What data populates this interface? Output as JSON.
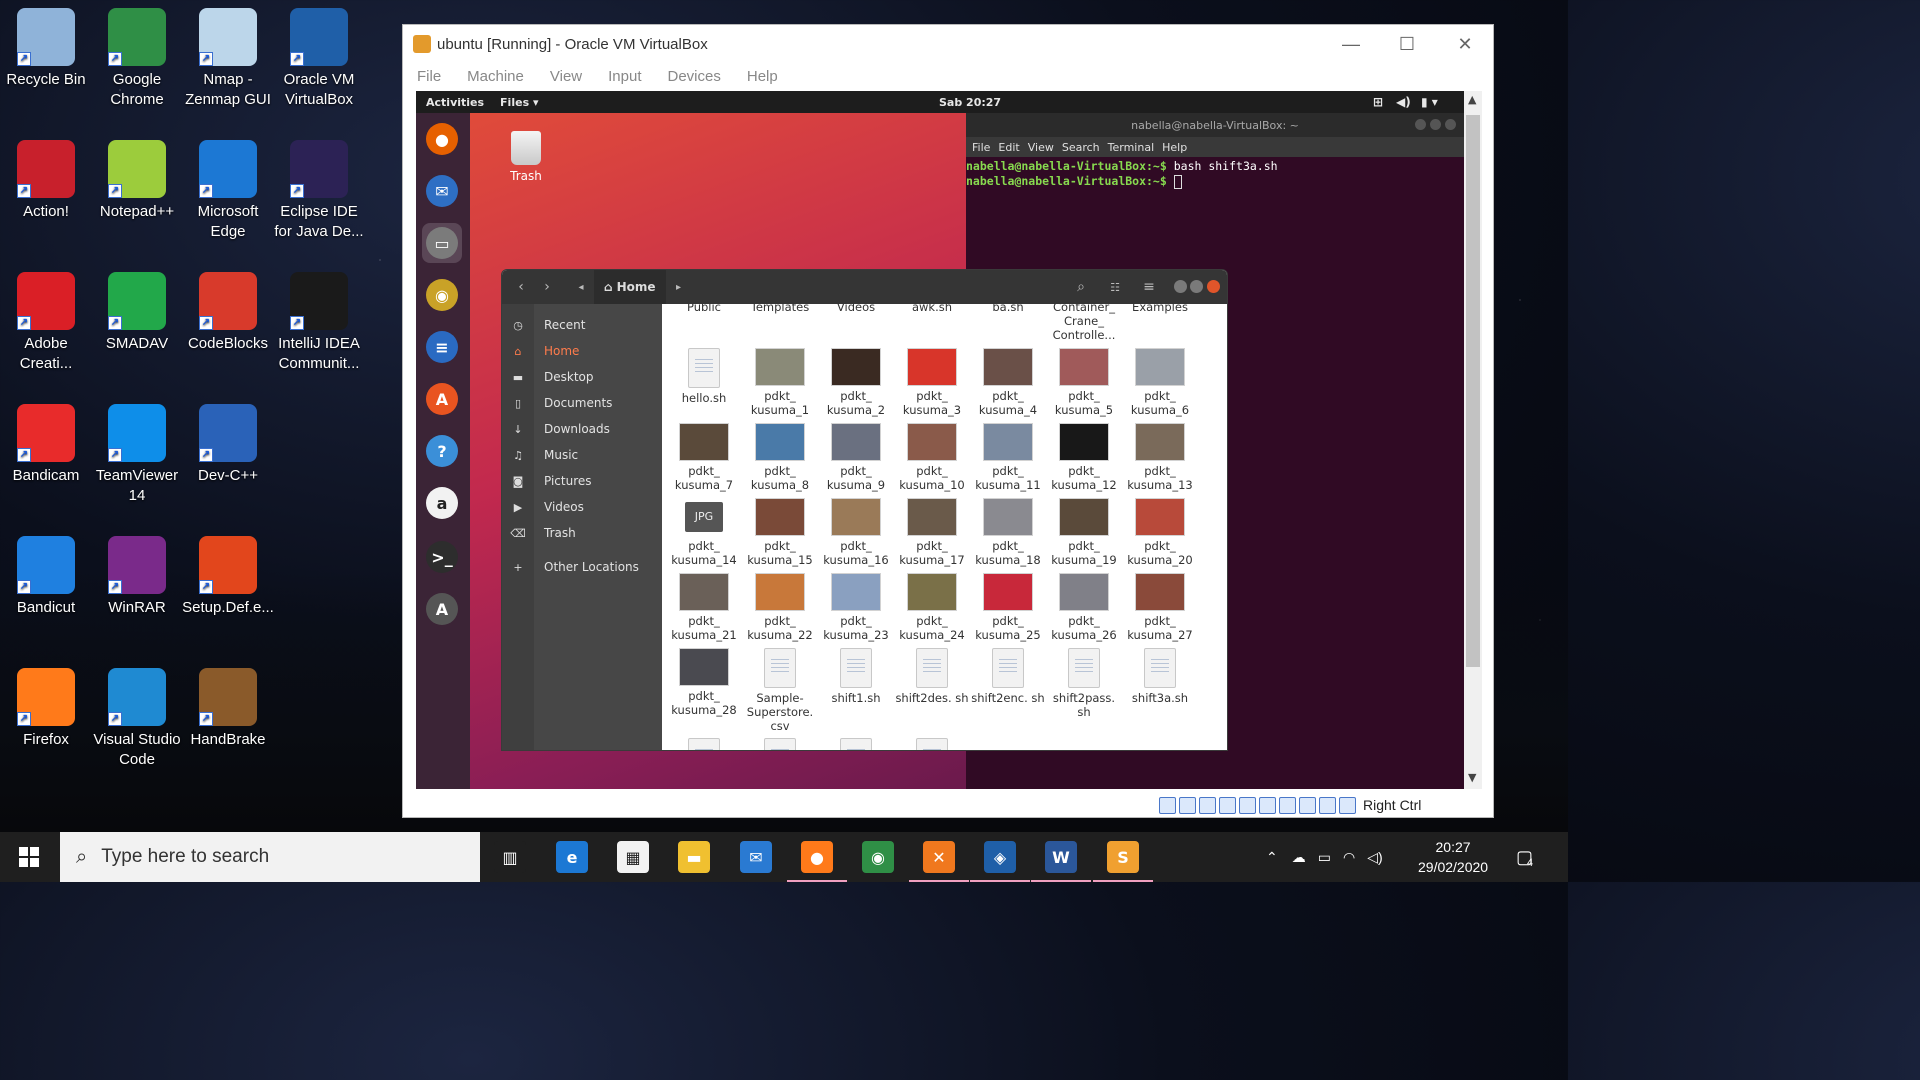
{
  "desktop": {
    "icons": [
      {
        "label": "Recycle Bin",
        "icon": "recycle-bin-icon",
        "color": "#8fb3d9"
      },
      {
        "label": "Google Chrome",
        "icon": "chrome-icon",
        "color": "#2f8f46"
      },
      {
        "label": "Nmap - Zenmap GUI",
        "icon": "eye-icon",
        "color": "#bcd6ea"
      },
      {
        "label": "Oracle VM VirtualBox",
        "icon": "virtualbox-icon",
        "color": "#1f5fa8"
      },
      {
        "label": "Action!",
        "icon": "action-icon",
        "color": "#c8202c"
      },
      {
        "label": "Notepad++",
        "icon": "notepadpp-icon",
        "color": "#9ccc3c"
      },
      {
        "label": "Microsoft Edge",
        "icon": "edge-icon",
        "color": "#1c78d4"
      },
      {
        "label": "Eclipse IDE for Java De...",
        "icon": "eclipse-icon",
        "color": "#2c2255"
      },
      {
        "label": "Adobe Creati...",
        "icon": "adobe-cc-icon",
        "color": "#da1f26"
      },
      {
        "label": "SMADAV",
        "icon": "smadav-icon",
        "color": "#22a84a"
      },
      {
        "label": "CodeBlocks",
        "icon": "codeblocks-icon",
        "color": "#d83a2b"
      },
      {
        "label": "IntelliJ IDEA Communit...",
        "icon": "intellij-icon",
        "color": "#1a1a1a"
      },
      {
        "label": "Bandicam",
        "icon": "bandicam-icon",
        "color": "#e82b2b"
      },
      {
        "label": "TeamViewer 14",
        "icon": "teamviewer-icon",
        "color": "#0e8ee9"
      },
      {
        "label": "Dev-C++",
        "icon": "devcpp-icon",
        "color": "#2a62b8"
      },
      {
        "label": "Bandicut",
        "icon": "bandicut-icon",
        "color": "#1f80e0"
      },
      {
        "label": "WinRAR",
        "icon": "winrar-icon",
        "color": "#7a2a8a"
      },
      {
        "label": "Setup.Def.e...",
        "icon": "office-icon",
        "color": "#e2461c"
      },
      {
        "label": "Firefox",
        "icon": "firefox-icon",
        "color": "#ff7a1a"
      },
      {
        "label": "Visual Studio Code",
        "icon": "vscode-icon",
        "color": "#1f8ad2"
      },
      {
        "label": "HandBrake",
        "icon": "handbrake-icon",
        "color": "#8a5a2a"
      }
    ]
  },
  "vbox": {
    "title": "ubuntu [Running] - Oracle VM VirtualBox",
    "menu": [
      "File",
      "Machine",
      "View",
      "Input",
      "Devices",
      "Help"
    ],
    "host_key": "Right Ctrl"
  },
  "ubuntu": {
    "activities": "Activities",
    "app_menu": "Files ▾",
    "clock": "Sab 20:27",
    "trash_label": "Trash",
    "dock": [
      {
        "name": "firefox",
        "color": "#e66000",
        "glyph": "●"
      },
      {
        "name": "thunderbird",
        "color": "#2e6fc4",
        "glyph": "✉"
      },
      {
        "name": "files",
        "color": "#7b7b7b",
        "glyph": "▭"
      },
      {
        "name": "rhythmbox",
        "color": "#c9a227",
        "glyph": "◉"
      },
      {
        "name": "writer",
        "color": "#2a6ac2",
        "glyph": "≡"
      },
      {
        "name": "software",
        "color": "#e95420",
        "glyph": "A"
      },
      {
        "name": "help",
        "color": "#3b8fd8",
        "glyph": "?"
      },
      {
        "name": "amazon",
        "color": "#f2f2f2",
        "glyph": "a"
      },
      {
        "name": "terminal",
        "color": "#2d2d2d",
        "glyph": ">_"
      },
      {
        "name": "updater",
        "color": "#555555",
        "glyph": "A"
      }
    ]
  },
  "terminal": {
    "title": "nabella@nabella-VirtualBox: ~",
    "menu": [
      "File",
      "Edit",
      "View",
      "Search",
      "Terminal",
      "Help"
    ],
    "lines": [
      {
        "prompt": "nabella@nabella-VirtualBox:~$",
        "cmd": " bash shift3a.sh"
      },
      {
        "prompt": "nabella@nabella-VirtualBox:~$",
        "cmd": " "
      }
    ]
  },
  "files": {
    "location": "Home",
    "sidebar": [
      {
        "label": "Recent",
        "icon": "clock-icon",
        "glyph": "◷"
      },
      {
        "label": "Home",
        "icon": "home-icon",
        "glyph": "⌂"
      },
      {
        "label": "Desktop",
        "icon": "folder-icon",
        "glyph": "▬"
      },
      {
        "label": "Documents",
        "icon": "document-icon",
        "glyph": "▯"
      },
      {
        "label": "Downloads",
        "icon": "download-icon",
        "glyph": "↓"
      },
      {
        "label": "Music",
        "icon": "music-icon",
        "glyph": "♫"
      },
      {
        "label": "Pictures",
        "icon": "camera-icon",
        "glyph": "◙"
      },
      {
        "label": "Videos",
        "icon": "video-icon",
        "glyph": "▶"
      },
      {
        "label": "Trash",
        "icon": "trash-icon",
        "glyph": "⌫"
      },
      {
        "label": "Other Locations",
        "icon": "plus-icon",
        "glyph": "+"
      }
    ],
    "top_row": [
      "Public",
      "Templates",
      "Videos",
      "awk.sh",
      "ba.sh",
      "Container_ Crane_ Controlle...",
      "Examples"
    ],
    "items": [
      {
        "label": "hello.sh",
        "kind": "doc",
        "color": ""
      },
      {
        "label": "pdkt_ kusuma_1",
        "kind": "img",
        "color": "#8a8a78"
      },
      {
        "label": "pdkt_ kusuma_2",
        "kind": "img",
        "color": "#3a2a22"
      },
      {
        "label": "pdkt_ kusuma_3",
        "kind": "img",
        "color": "#d8352a"
      },
      {
        "label": "pdkt_ kusuma_4",
        "kind": "img",
        "color": "#6a5048"
      },
      {
        "label": "pdkt_ kusuma_5",
        "kind": "img",
        "color": "#a05a5a"
      },
      {
        "label": "pdkt_ kusuma_6",
        "kind": "img",
        "color": "#9aa0a8"
      },
      {
        "label": "pdkt_ kusuma_7",
        "kind": "img",
        "color": "#5a4a3a"
      },
      {
        "label": "pdkt_ kusuma_8",
        "kind": "img",
        "color": "#4a7aa8"
      },
      {
        "label": "pdkt_ kusuma_9",
        "kind": "img",
        "color": "#6a7080"
      },
      {
        "label": "pdkt_ kusuma_10",
        "kind": "img",
        "color": "#8a5a4a"
      },
      {
        "label": "pdkt_ kusuma_11",
        "kind": "img",
        "color": "#7a8aa0"
      },
      {
        "label": "pdkt_ kusuma_12",
        "kind": "img",
        "color": "#181818"
      },
      {
        "label": "pdkt_ kusuma_13",
        "kind": "img",
        "color": "#7a6a5a"
      },
      {
        "label": "pdkt_ kusuma_14",
        "kind": "jpg",
        "color": ""
      },
      {
        "label": "pdkt_ kusuma_15",
        "kind": "img",
        "color": "#7a4a38"
      },
      {
        "label": "pdkt_ kusuma_16",
        "kind": "img",
        "color": "#9a7a58"
      },
      {
        "label": "pdkt_ kusuma_17",
        "kind": "img",
        "color": "#6a5a4a"
      },
      {
        "label": "pdkt_ kusuma_18",
        "kind": "img",
        "color": "#8a8a90"
      },
      {
        "label": "pdkt_ kusuma_19",
        "kind": "img",
        "color": "#5a4a3a"
      },
      {
        "label": "pdkt_ kusuma_20",
        "kind": "img",
        "color": "#b84a3a"
      },
      {
        "label": "pdkt_ kusuma_21",
        "kind": "img",
        "color": "#6a6058"
      },
      {
        "label": "pdkt_ kusuma_22",
        "kind": "img",
        "color": "#c8783a"
      },
      {
        "label": "pdkt_ kusuma_23",
        "kind": "img",
        "color": "#8aa0c0"
      },
      {
        "label": "pdkt_ kusuma_24",
        "kind": "img",
        "color": "#7a7048"
      },
      {
        "label": "pdkt_ kusuma_25",
        "kind": "img",
        "color": "#c8283a"
      },
      {
        "label": "pdkt_ kusuma_26",
        "kind": "img",
        "color": "#808088"
      },
      {
        "label": "pdkt_ kusuma_27",
        "kind": "img",
        "color": "#8a4a3a"
      },
      {
        "label": "pdkt_ kusuma_28",
        "kind": "img",
        "color": "#4a4a50"
      },
      {
        "label": "Sample- Superstore. csv",
        "kind": "doc",
        "color": ""
      },
      {
        "label": "shift1.sh",
        "kind": "doc",
        "color": ""
      },
      {
        "label": "shift2des. sh",
        "kind": "doc",
        "color": ""
      },
      {
        "label": "shift2enc. sh",
        "kind": "doc",
        "color": ""
      },
      {
        "label": "shift2pass. sh",
        "kind": "doc",
        "color": ""
      },
      {
        "label": "shift3a.sh",
        "kind": "doc",
        "color": ""
      }
    ]
  },
  "taskbar": {
    "search_placeholder": "Type here to search",
    "time": "20:27",
    "date": "29/02/2020",
    "notification_count": "4",
    "apps": [
      {
        "name": "task-view",
        "color": "#1f1f1f",
        "glyph": "▥",
        "active": false
      },
      {
        "name": "edge",
        "color": "#1c78d4",
        "glyph": "e",
        "active": false
      },
      {
        "name": "store",
        "color": "#f2f2f2",
        "glyph": "▦",
        "active": false
      },
      {
        "name": "file-explorer",
        "color": "#f0c030",
        "glyph": "▬",
        "active": false
      },
      {
        "name": "mail",
        "color": "#2a7ad2",
        "glyph": "✉",
        "active": false
      },
      {
        "name": "firefox",
        "color": "#ff7a1a",
        "glyph": "●",
        "active": true
      },
      {
        "name": "chrome",
        "color": "#2f8f46",
        "glyph": "◉",
        "active": false
      },
      {
        "name": "xampp",
        "color": "#f0781e",
        "glyph": "✕",
        "active": true
      },
      {
        "name": "virtualbox",
        "color": "#1f5fa8",
        "glyph": "◈",
        "active": true
      },
      {
        "name": "word",
        "color": "#2b579a",
        "glyph": "W",
        "active": true
      },
      {
        "name": "sublime",
        "color": "#f0a030",
        "glyph": "S",
        "active": true
      }
    ]
  }
}
